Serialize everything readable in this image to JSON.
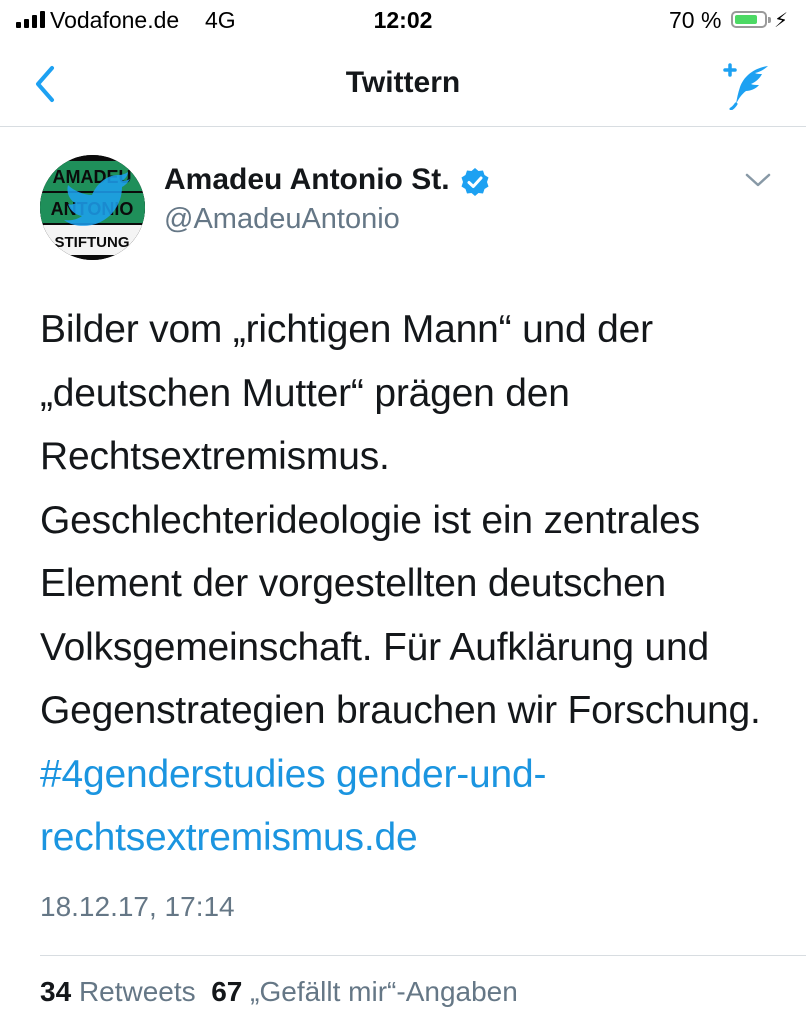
{
  "status_bar": {
    "carrier": "Vodafone.de",
    "network": "4G",
    "time": "12:02",
    "battery_percent": "70 %",
    "battery_level": 0.7,
    "colors": {
      "battery_fill": "#4cd964"
    }
  },
  "nav": {
    "title": "Twittern",
    "back_icon": "chevron-left-icon",
    "compose_icon": "compose-tweet-icon",
    "accent": "#1da1f2"
  },
  "tweet": {
    "author": {
      "display_name": "Amadeu Antonio St.",
      "handle": "@AmadeuAntonio",
      "verified": true,
      "avatar_lettering": [
        "AMADEU",
        "ANTONIO",
        "STIFTUNG"
      ]
    },
    "text": "Bilder vom „richtigen Mann“ und der „deutschen Mutter“ prägen den Rechtsextremismus. Geschlechterideologie ist ein zentrales Element der vorgestellten deutschen Volksgemeinschaft. Für Aufklärung und Gegenstrategien brauchen wir Forschung.",
    "hashtag": "#4genderstudies",
    "url": "gender-und-rechtsextremismus.de",
    "timestamp": "18.12.17, 17:14",
    "stats": {
      "retweets_count": "34",
      "retweets_label": "Retweets",
      "likes_count": "67",
      "likes_label": "„Gefällt mir“-Angaben"
    },
    "colors": {
      "link": "#1b95e0",
      "secondary": "#657786"
    }
  }
}
